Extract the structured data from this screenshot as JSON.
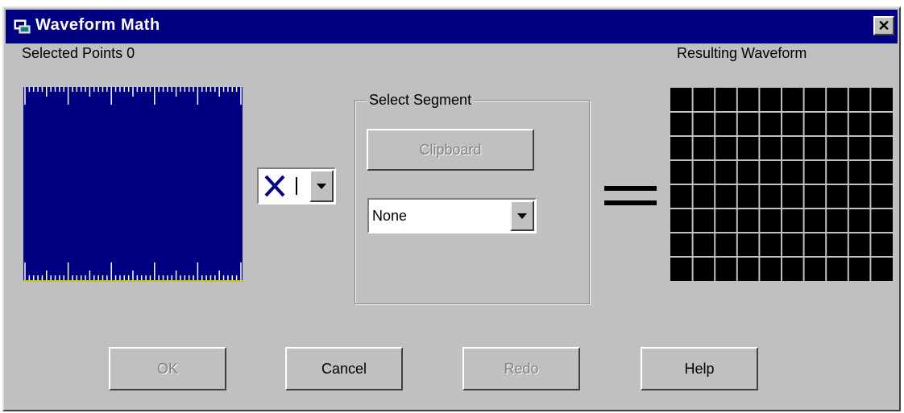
{
  "window": {
    "title": "Waveform Math",
    "close_glyph": "✕",
    "title_icon": "scope-window-icon",
    "titlebar_color": "#000080"
  },
  "selected_points": {
    "label": "Selected Points  0"
  },
  "source_waveform": {
    "background": "#000080",
    "tick_color": "#ffffff",
    "baseline_color": "#c8c800"
  },
  "operator": {
    "symbol": "×",
    "icon": "multiply-operator-icon"
  },
  "segment": {
    "legend": "Select Segment",
    "clipboard_label": "Clipboard",
    "selected_value": "None"
  },
  "equals": {
    "icon": "equals-sign-icon"
  },
  "result": {
    "label": "Resulting Waveform",
    "background": "#000000",
    "grid_color": "#c0c0c0"
  },
  "buttons": {
    "ok": "OK",
    "cancel": "Cancel",
    "redo": "Redo",
    "help": "Help"
  }
}
